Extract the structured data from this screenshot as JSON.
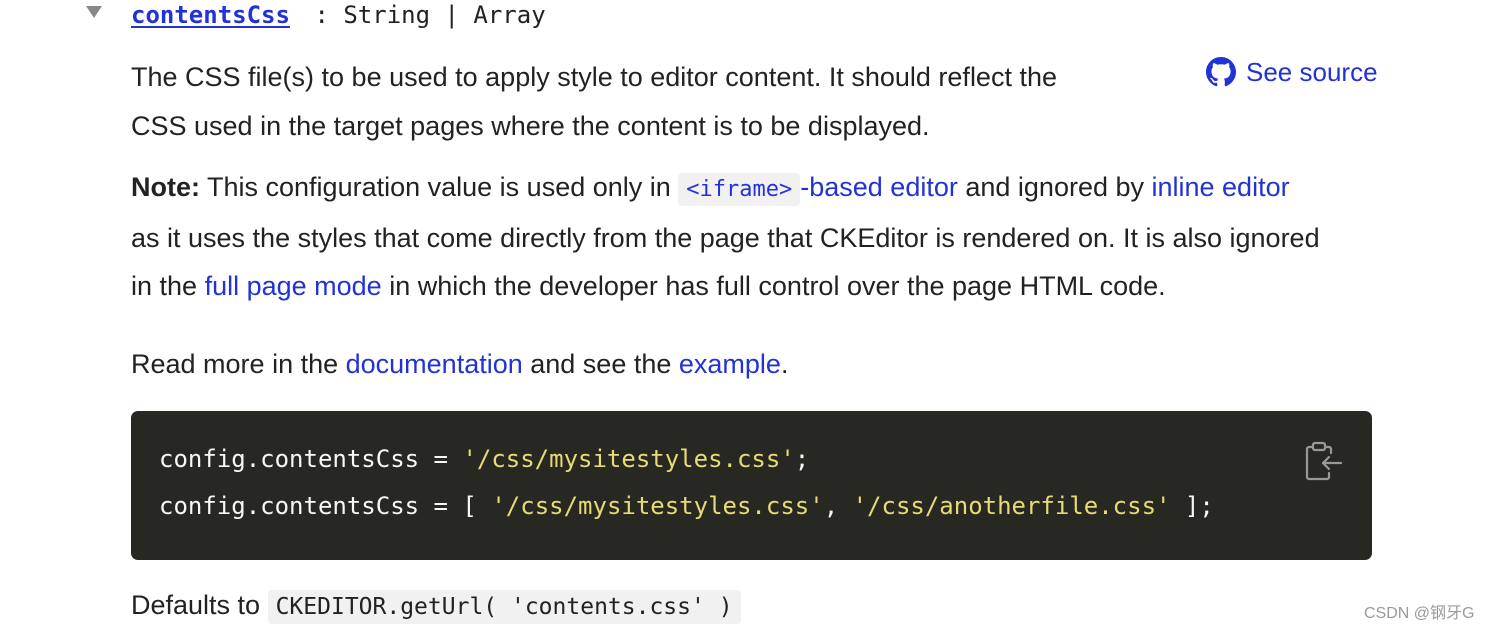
{
  "member": {
    "name": "contentsCss",
    "type_sep": " : String | Array"
  },
  "see_source": {
    "label": "See source",
    "icon": "github-icon"
  },
  "description": {
    "line1": "The CSS file(s) to be used to apply style to editor content. It should reflect the",
    "line2": "CSS used in the target pages where the content is to be displayed."
  },
  "note": {
    "label": "Note:",
    "text1": " This configuration value is used only in ",
    "iframe_code": "<iframe>",
    "iframe_link": "-based editor",
    "text2": " and ignored by ",
    "inline_link": "inline editor",
    "line2": "as it uses the styles that come directly from the page that CKEditor is rendered on. It is also ignored",
    "line3_start": "in the ",
    "full_page_link": "full page mode",
    "line3_end": " in which the developer has full control over the page HTML code."
  },
  "read_more": {
    "text1": "Read more in the ",
    "doc_link": "documentation",
    "text2": " and see the ",
    "example_link": "example",
    "text3": "."
  },
  "code": {
    "line1_prefix": "config.contentsCss = ",
    "line1_str": "'/css/mysitestyles.css'",
    "line1_suffix": ";",
    "line2_prefix": "config.contentsCss = [ ",
    "line2_str1": "'/css/mysitestyles.css'",
    "line2_mid": ", ",
    "line2_str2": "'/css/anotherfile.css'",
    "line2_suffix": " ];",
    "copy_icon": "clipboard-copy-icon"
  },
  "defaults": {
    "label": "Defaults to ",
    "value": "CKEDITOR.getUrl( 'contents.css' )"
  },
  "watermark": "CSDN @钢牙G",
  "colors": {
    "link": "#2232d6",
    "code_bg": "#272822",
    "code_string": "#e6db74",
    "code_text": "#f8f8f2",
    "inline_code_bg": "#f1f1f1"
  }
}
